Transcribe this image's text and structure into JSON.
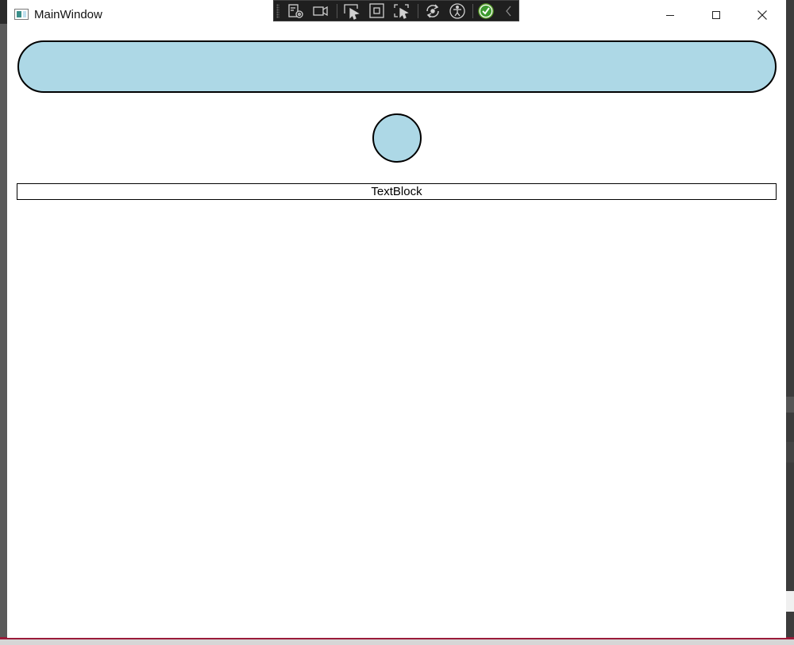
{
  "window": {
    "title": "MainWindow",
    "icon": "app-window-icon",
    "controls": {
      "minimize_icon": "minimize-icon",
      "maximize_icon": "maximize-icon",
      "close_icon": "close-icon"
    }
  },
  "debug_toolbar": {
    "tools": [
      "live-visual-tree-icon",
      "record-icon",
      "select-element-icon",
      "display-layout-adorners-icon",
      "track-focused-element-icon",
      "hot-reload-icon",
      "accessibility-icon",
      "binding-ok-icon",
      "collapse-chevron-icon"
    ]
  },
  "content": {
    "pill_fill": "#add8e6",
    "circle_fill": "#add8e6",
    "textblock_text": "TextBlock"
  }
}
